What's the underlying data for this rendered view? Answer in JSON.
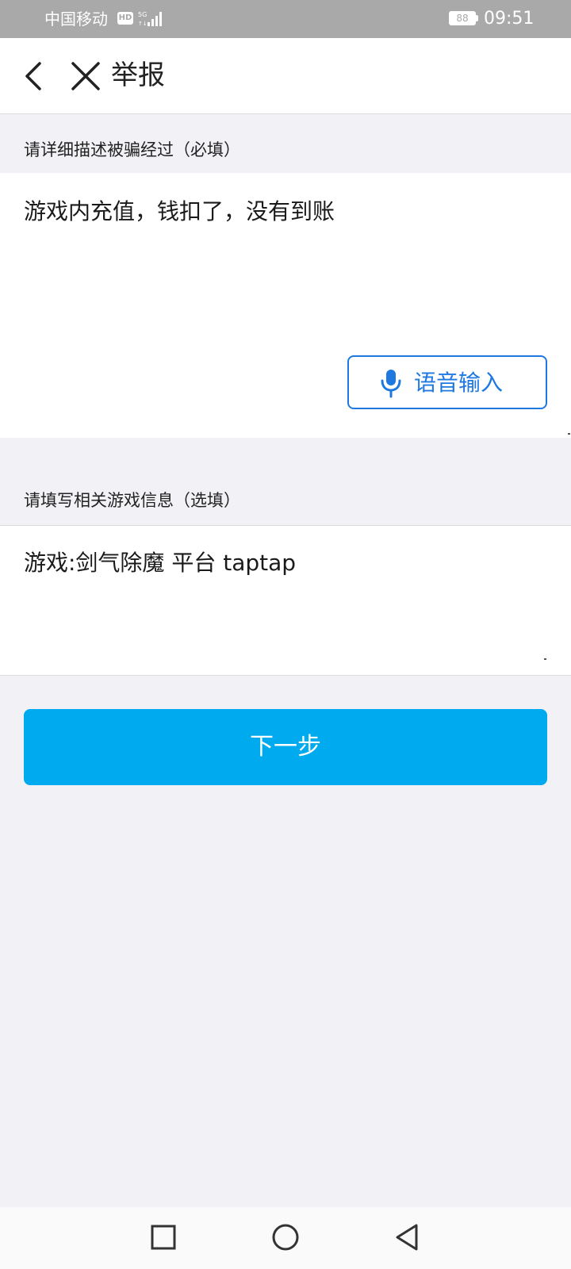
{
  "status_bar": {
    "carrier": "中国移动",
    "network_badge": "HD",
    "signal_icon": "signal-5g-icon",
    "battery_level": "88",
    "time": "09:51"
  },
  "header": {
    "back_icon": "chevron-left-icon",
    "close_icon": "close-icon",
    "title": "举报"
  },
  "description_section": {
    "label": "请详细描述被骗经过（必填）",
    "value": "游戏内充值，钱扣了，没有到账",
    "voice_button": {
      "icon": "microphone-icon",
      "label": "语音输入"
    }
  },
  "game_info_section": {
    "label": "请填写相关游戏信息（选填）",
    "value": "游戏:剑气除魔 平台 taptap"
  },
  "next_button": {
    "label": "下一步"
  },
  "nav_bar": {
    "recents_icon": "square-icon",
    "home_icon": "circle-icon",
    "back_icon": "triangle-back-icon"
  },
  "colors": {
    "accent": "#00aaee",
    "voice_accent": "#1e78e0",
    "page_background": "#f2f2f6",
    "status_bar": "#a9a9a9"
  }
}
